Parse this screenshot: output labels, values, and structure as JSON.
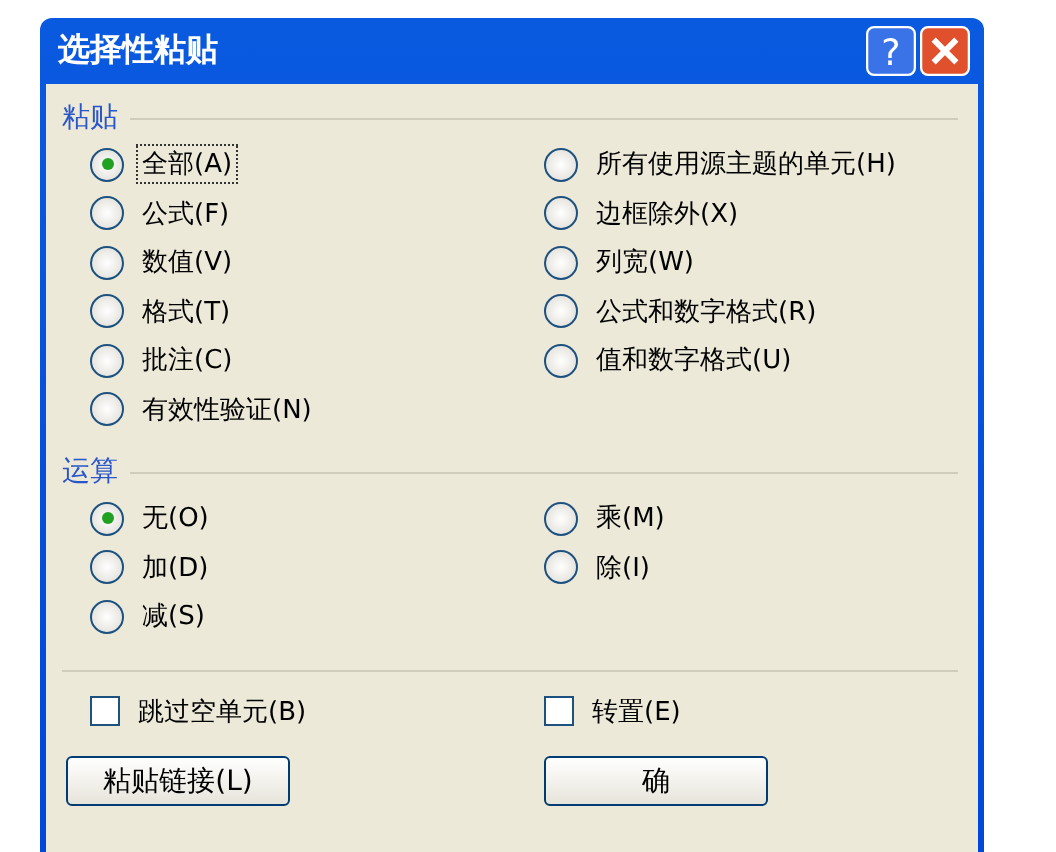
{
  "window": {
    "title": "选择性粘贴",
    "help_button": "?"
  },
  "paste": {
    "heading": "粘贴",
    "options": [
      {
        "label": "全部(A)",
        "selected": true
      },
      {
        "label": "所有使用源主题的单元(H)",
        "selected": false
      },
      {
        "label": "公式(F)",
        "selected": false
      },
      {
        "label": "边框除外(X)",
        "selected": false
      },
      {
        "label": "数值(V)",
        "selected": false
      },
      {
        "label": "列宽(W)",
        "selected": false
      },
      {
        "label": "格式(T)",
        "selected": false
      },
      {
        "label": "公式和数字格式(R)",
        "selected": false
      },
      {
        "label": "批注(C)",
        "selected": false
      },
      {
        "label": "值和数字格式(U)",
        "selected": false
      },
      {
        "label": "有效性验证(N)",
        "selected": false
      }
    ]
  },
  "operation": {
    "heading": "运算",
    "options": [
      {
        "label": "无(O)",
        "selected": true
      },
      {
        "label": "乘(M)",
        "selected": false
      },
      {
        "label": "加(D)",
        "selected": false
      },
      {
        "label": "除(I)",
        "selected": false
      },
      {
        "label": "减(S)",
        "selected": false
      }
    ]
  },
  "checkboxes": [
    {
      "label": "跳过空单元(B)",
      "checked": false
    },
    {
      "label": "转置(E)",
      "checked": false
    }
  ],
  "buttons": [
    "粘贴链接(L)",
    "确"
  ]
}
